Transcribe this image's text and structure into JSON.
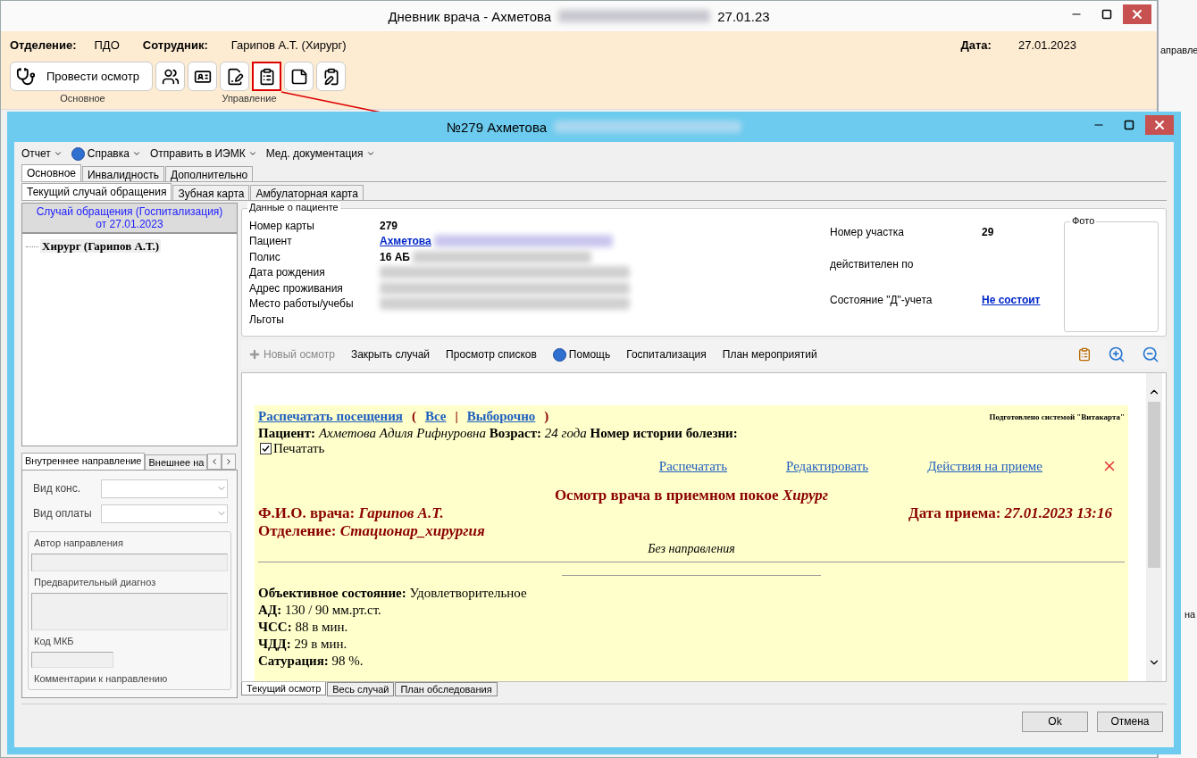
{
  "background_window": {
    "texts": [
      "аправле",
      "на"
    ]
  },
  "outer_window": {
    "title": "Дневник врача - Ахметова",
    "title_date": "27.01.23",
    "header": {
      "department_label": "Отделение:",
      "department": "ПДО",
      "employee_label": "Сотрудник:",
      "employee": "Гарипов А.Т. (Хирург)",
      "date_label": "Дата:",
      "date": "27.01.2023"
    },
    "ribbon": {
      "main_button": "Провести осмотр",
      "icon_buttons": [
        {
          "selected": false
        },
        {
          "selected": false
        },
        {
          "selected": false
        },
        {
          "selected": true
        },
        {
          "selected": false
        },
        {
          "selected": false
        }
      ],
      "groups": [
        "Основное",
        "Управление"
      ]
    }
  },
  "dialog": {
    "title": "№279 Ахметова",
    "menu": [
      {
        "label": "Отчет",
        "kind": "dropdown"
      },
      {
        "label": "Справка",
        "kind": "help"
      },
      {
        "label": "Отправить в ИЭМК",
        "kind": "dropdown"
      },
      {
        "label": "Мед. документация",
        "kind": "dropdown"
      }
    ],
    "tabs": [
      {
        "label": "Основное",
        "selected": true
      },
      {
        "label": "Инвалидность",
        "selected": false
      },
      {
        "label": "Дополнительно",
        "selected": false
      }
    ],
    "subtabs": [
      {
        "label": "Текущий случай обращения",
        "selected": true
      },
      {
        "label": "Зубная карта",
        "selected": false
      },
      {
        "label": "Амбулаторная карта",
        "selected": false
      }
    ],
    "case_panel": {
      "header": "Случай обращения (Госпитализация)",
      "header_date": "от 27.01.2023",
      "tree": [
        {
          "label": "Хирург (Гарипов А.Т.)",
          "selected": true
        }
      ],
      "referral_tabs": [
        {
          "label": "Внутреннее направление",
          "selected": true
        },
        {
          "label": "Внешнее на",
          "selected": false
        }
      ],
      "form": {
        "consult_type_label": "Вид конс.",
        "payment_label": "Вид оплаты",
        "author_label": "Автор направления",
        "diagnosis_label": "Предварительный диагноз",
        "icd_label": "Код МКБ",
        "comment_label": "Комментарии к направлению"
      }
    },
    "patient": {
      "group_title": "Данные о пациенте",
      "rows": [
        {
          "label": "Номер карты",
          "value": "279",
          "kind": "plain",
          "blurred": false
        },
        {
          "label": "Пациент",
          "value": "Ахметова",
          "kind": "link",
          "blurred": true
        },
        {
          "label": "Полис",
          "value": "16 АБ",
          "kind": "plain",
          "blurred": true
        },
        {
          "label": "Дата рождения",
          "kind": "empty",
          "blurred": true
        },
        {
          "label": "Адрес проживания",
          "kind": "empty",
          "blurred": true
        },
        {
          "label": "Место работы/учебы",
          "kind": "empty",
          "blurred": true
        },
        {
          "label": "Льготы",
          "kind": "empty",
          "blurred": false
        }
      ],
      "right_rows": [
        {
          "label": "Номер участка",
          "value": "29",
          "kind": "plain"
        },
        {
          "label": "действителен по",
          "kind": "empty"
        },
        {
          "label": "Состояние \"Д\"-учета",
          "value": "Не состоит",
          "kind": "link"
        }
      ],
      "photo_title": "Фото"
    },
    "toolbar": [
      {
        "label": "Новый осмотр",
        "kind": "plus",
        "disabled": true
      },
      {
        "label": "Закрыть случай",
        "kind": "text",
        "disabled": false
      },
      {
        "label": "Просмотр списков",
        "kind": "text",
        "disabled": false
      },
      {
        "label": "Помощь",
        "kind": "help",
        "disabled": false
      },
      {
        "label": "Госпитализация",
        "kind": "text",
        "disabled": false
      },
      {
        "label": "План мероприятий",
        "kind": "text",
        "disabled": false
      }
    ],
    "document": {
      "print_links": [
        {
          "label": "Распечатать посещения",
          "kind": "link"
        },
        {
          "label": "(",
          "kind": "sep"
        },
        {
          "label": "Все",
          "kind": "link"
        },
        {
          "label": "|",
          "kind": "sep"
        },
        {
          "label": "Выборочно",
          "kind": "link"
        },
        {
          "label": ")",
          "kind": "sep"
        }
      ],
      "prepared_by": "Подготовлено системой \"Витакарта\"",
      "patient_line": "**Пациент:** *Ахметова Адиля Рифнуровна* **Возраст:** *24 года* **Номер истории болезни:**",
      "print_checkbox": {
        "label": "Печатать",
        "checked": true
      },
      "actions": [
        "Распечатать",
        "Редактировать",
        "Действия на приеме"
      ],
      "heading": {
        "text": "Осмотр врача в приемном покое",
        "specialty": "Хирург"
      },
      "doctor": {
        "label": "Ф.И.О. врача:",
        "value": "Гарипов А.Т."
      },
      "visit_date": {
        "label": "Дата приема:",
        "value": "27.01.2023 13:16"
      },
      "department": {
        "label": "Отделение:",
        "value": "Стационар_хирургия"
      },
      "referral_note": "Без направления",
      "findings": [
        "**Объективное состояние:** Удовлетворительное",
        "**АД:** 130 / 90 мм.рт.ст.",
        "**ЧСС:** 88 в мин.",
        "**ЧДД:** 29 в мин.",
        "**Сатурация:** 98 %."
      ]
    },
    "bottom_tabs": [
      {
        "label": "Текущий осмотр",
        "selected": true
      },
      {
        "label": "Весь случай",
        "selected": false
      },
      {
        "label": "План обследования",
        "selected": false
      }
    ],
    "buttons": [
      "Ok",
      "Отмена"
    ]
  }
}
